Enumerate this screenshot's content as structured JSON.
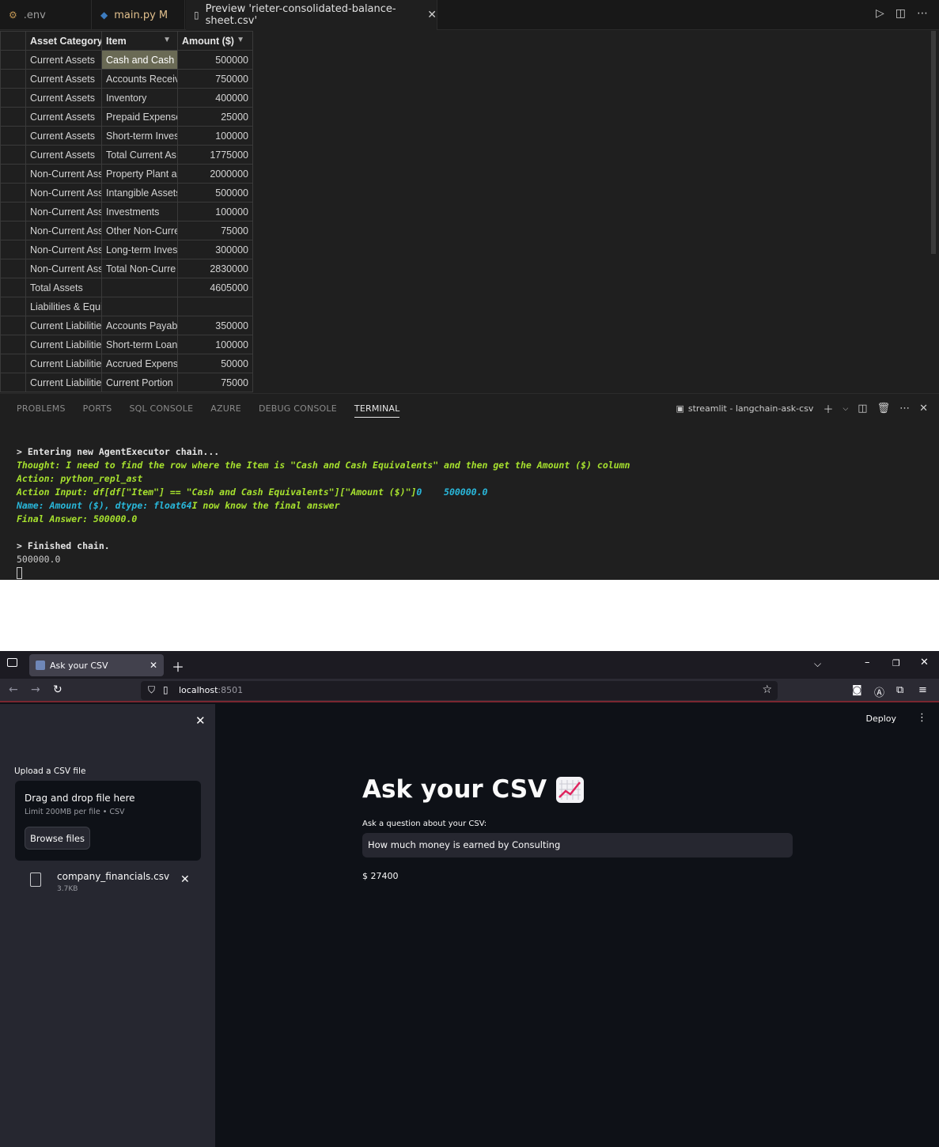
{
  "vscode": {
    "tabs": [
      {
        "label": ".env",
        "icon": "settings-icon"
      },
      {
        "label": "main.py M",
        "icon": "python-icon"
      },
      {
        "label": "Preview 'rieter-consolidated-balance-sheet.csv'",
        "icon": "file-preview-icon"
      }
    ],
    "csv": {
      "headers": [
        "Asset Category",
        "Item",
        "Amount ($)"
      ],
      "rows": [
        [
          "Current Assets",
          "Cash and Cash E",
          "500000"
        ],
        [
          "Current Assets",
          "Accounts Receiv",
          "750000"
        ],
        [
          "Current Assets",
          "Inventory",
          "400000"
        ],
        [
          "Current Assets",
          "Prepaid Expense",
          "25000"
        ],
        [
          "Current Assets",
          "Short-term Inves",
          "100000"
        ],
        [
          "Current Assets",
          "Total Current As:",
          "1775000"
        ],
        [
          "Non-Current Ass",
          "Property Plant ar",
          "2000000"
        ],
        [
          "Non-Current Ass",
          "Intangible Assets",
          "500000"
        ],
        [
          "Non-Current Ass",
          "Investments",
          "100000"
        ],
        [
          "Non-Current Ass",
          "Other Non-Curre",
          "75000"
        ],
        [
          "Non-Current Ass",
          "Long-term Inves",
          "300000"
        ],
        [
          "Non-Current Ass",
          "Total Non-Curre",
          "2830000"
        ],
        [
          "Total Assets",
          "",
          "4605000"
        ],
        [
          "Liabilities & Equi",
          "",
          ""
        ],
        [
          "Current Liabilitie",
          "Accounts Payabl",
          "350000"
        ],
        [
          "Current Liabilitie",
          "Short-term Loan",
          "100000"
        ],
        [
          "Current Liabilitie",
          "Accrued Expense",
          "50000"
        ],
        [
          "Current Liabilitie",
          "Current Portion",
          "75000"
        ]
      ]
    },
    "panel": {
      "tabs": [
        "PROBLEMS",
        "PORTS",
        "SQL CONSOLE",
        "AZURE",
        "DEBUG CONSOLE",
        "TERMINAL"
      ],
      "active_tab": "TERMINAL",
      "terminal_name": "streamlit - langchain-ask-csv"
    },
    "terminal": {
      "line1": "> Entering new AgentExecutor chain...",
      "line2": "Thought: I need to find the row where the Item is \"Cash and Cash Equivalents\" and then get the Amount ($) column",
      "line3": "Action: python_repl_ast",
      "line4a": "Action Input: df[df[\"Item\"] == \"Cash and Cash Equivalents\"][\"Amount ($)\"]",
      "line4b": "0    500000.0",
      "line5a": "Name: Amount ($), dtype: float64",
      "line5b": "I now know the final answer",
      "line6": "Final Answer: 500000.0",
      "line7": "> Finished chain.",
      "line8": "500000.0"
    }
  },
  "browser": {
    "tab_title": "Ask your CSV",
    "url_host": "localhost",
    "url_port": ":8501",
    "sidebar": {
      "upload_label": "Upload a CSV file",
      "drop_title": "Drag and drop file here",
      "drop_limit": "Limit 200MB per file • CSV",
      "browse_label": "Browse files",
      "file_name": "company_financials.csv",
      "file_size": "3.7KB"
    },
    "main": {
      "deploy_label": "Deploy",
      "title": "Ask your CSV",
      "title_icon": "chart-increasing-icon",
      "question_label": "Ask a question about your CSV:",
      "question_value": "How much money is earned by Consulting",
      "answer": "$ 27400"
    }
  }
}
